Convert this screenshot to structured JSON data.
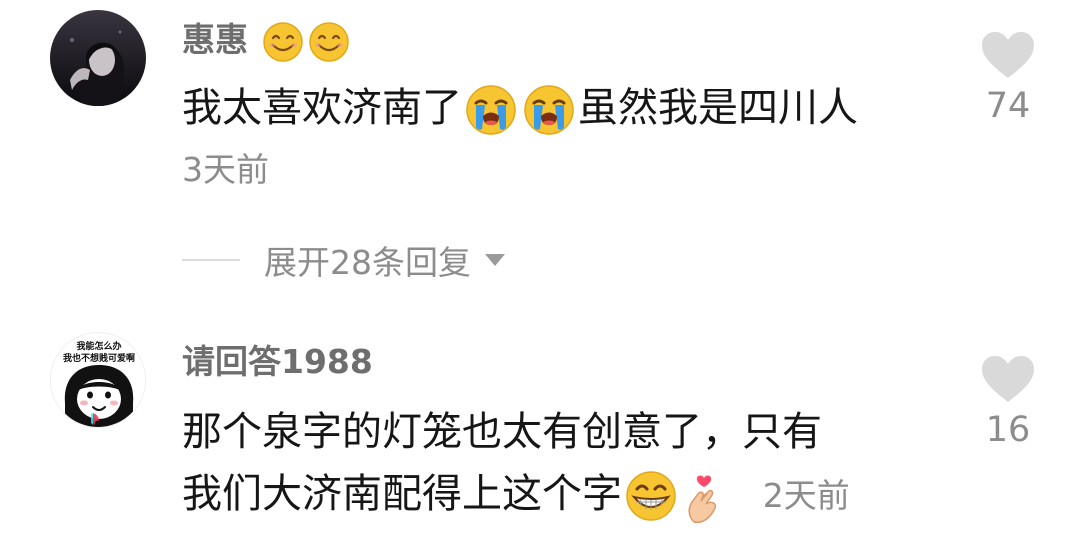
{
  "comments": [
    {
      "username": "惠惠",
      "text_parts": [
        "我太喜欢济南了",
        "虽然我是四川人"
      ],
      "time": "3天前",
      "likes": "74",
      "avatar_icon": "dark-portrait-avatar",
      "username_emojis": [
        "smile-emoji",
        "smile-emoji"
      ],
      "text_emojis": [
        "crying-emoji",
        "crying-emoji"
      ]
    },
    {
      "username": "请回答1988",
      "avatar_text": [
        "我能怎么办",
        "我也不想贱可爱啊"
      ],
      "avatar_icon": "cartoon-face-avatar",
      "text_line1": "那个泉字的灯笼也太有创意了，只有",
      "text_line2": "我们大济南配得上这个字",
      "time": "2天前",
      "likes": "16",
      "text_emojis": [
        "grin-emoji",
        "finger-heart-emoji"
      ]
    }
  ],
  "expand_replies": {
    "label": "展开28条回复",
    "icon": "triangle-down-icon"
  },
  "colors": {
    "username": "#6e6e6e",
    "text": "#161616",
    "meta": "#8c8c8c",
    "heart": "#d9d9d9",
    "emoji_yellow": "#f7c531",
    "tear_blue": "#3a9ce8"
  }
}
